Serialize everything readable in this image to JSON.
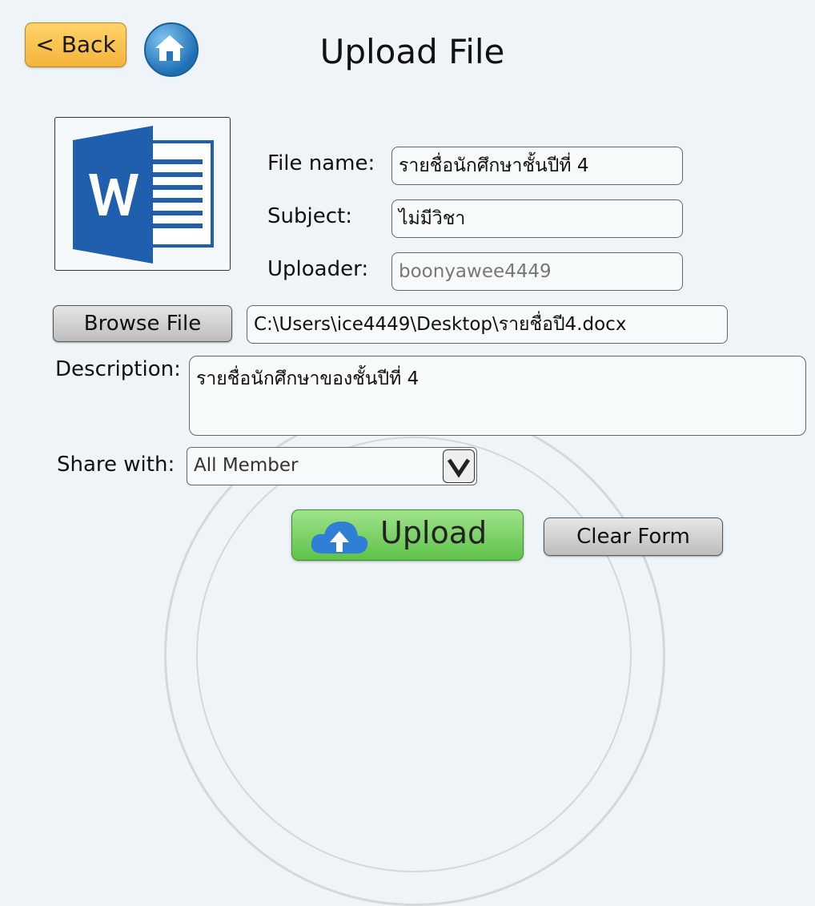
{
  "header": {
    "back_label": "< Back",
    "title": "Upload File",
    "home_icon": "home-icon"
  },
  "file_icon": "word-document-icon",
  "form": {
    "file_name_label": "File name:",
    "file_name_value": "รายชื่อนักศึกษาชั้นปีที่ 4",
    "subject_label": "Subject:",
    "subject_value": "ไม่มีวิชา",
    "uploader_label": "Uploader:",
    "uploader_value": "boonyawee4449",
    "browse_label": "Browse File",
    "file_path": "C:\\Users\\ice4449\\Desktop\\รายชื่อปี4.docx",
    "description_label": "Description:",
    "description_value": "รายชื่อนักศึกษาของชั้นปีที่ 4",
    "share_label": "Share with:",
    "share_value": "All Member"
  },
  "actions": {
    "upload_label": "Upload",
    "clear_label": "Clear Form"
  },
  "colors": {
    "back_button": "#f4b43a",
    "home_button": "#1f6fb5",
    "word_blue": "#1f5fae",
    "upload_button": "#5ec24a"
  }
}
